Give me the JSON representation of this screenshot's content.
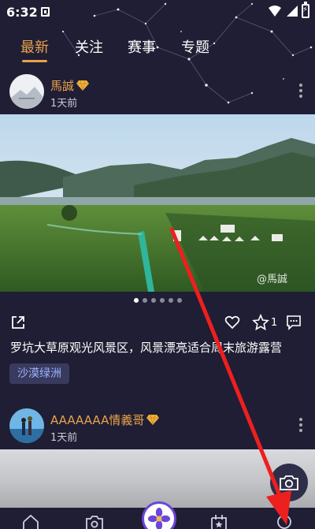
{
  "status_bar": {
    "time": "6:32"
  },
  "tabs": [
    {
      "label": "最新",
      "active": true
    },
    {
      "label": "关注",
      "active": false
    },
    {
      "label": "赛事",
      "active": false
    },
    {
      "label": "专题",
      "active": false
    }
  ],
  "post1": {
    "author": "馬誠",
    "time": "1天前",
    "watermark": "@馬誠",
    "like_count": "1",
    "text": "罗坑大草原观光风景区，风景漂亮适合周末旅游露营",
    "tag": "沙漠绿洲",
    "carousel": {
      "count": 6,
      "active_index": 0
    }
  },
  "post2": {
    "author": "AAAAAAA情義哥",
    "time": "1天前"
  },
  "colors": {
    "accent": "#e9a24a",
    "background": "#1f1e34",
    "annotation_arrow": "#ee1f1f"
  },
  "icons": {
    "share": "share-icon",
    "like": "heart-icon",
    "favorite": "star-icon",
    "comment": "comment-icon",
    "camera": "camera-icon",
    "nav_home": "home-icon",
    "nav_camera": "camera-icon",
    "nav_center": "flower-icon",
    "nav_calendar": "calendar-icon",
    "nav_profile": "profile-icon"
  }
}
